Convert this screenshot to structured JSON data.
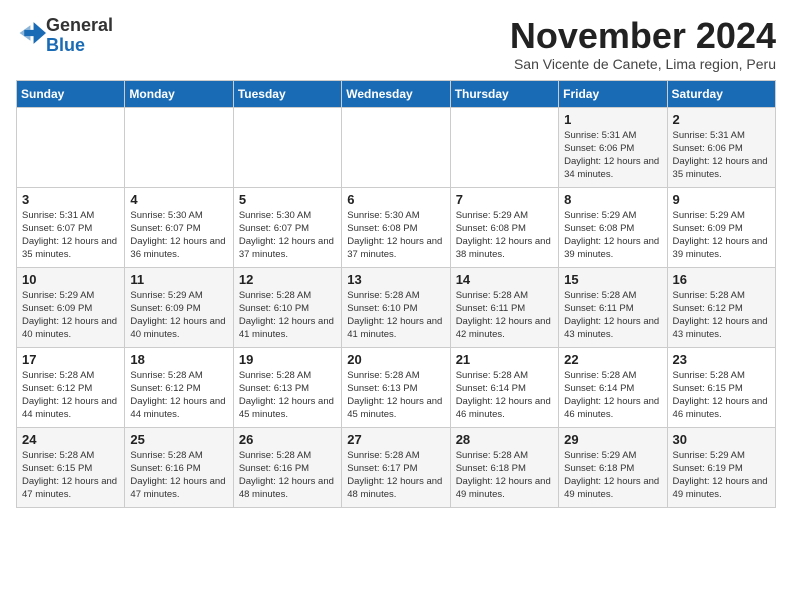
{
  "header": {
    "logo_general": "General",
    "logo_blue": "Blue",
    "month_year": "November 2024",
    "location": "San Vicente de Canete, Lima region, Peru"
  },
  "weekdays": [
    "Sunday",
    "Monday",
    "Tuesday",
    "Wednesday",
    "Thursday",
    "Friday",
    "Saturday"
  ],
  "weeks": [
    [
      {
        "day": "",
        "info": ""
      },
      {
        "day": "",
        "info": ""
      },
      {
        "day": "",
        "info": ""
      },
      {
        "day": "",
        "info": ""
      },
      {
        "day": "",
        "info": ""
      },
      {
        "day": "1",
        "info": "Sunrise: 5:31 AM\nSunset: 6:06 PM\nDaylight: 12 hours and 34 minutes."
      },
      {
        "day": "2",
        "info": "Sunrise: 5:31 AM\nSunset: 6:06 PM\nDaylight: 12 hours and 35 minutes."
      }
    ],
    [
      {
        "day": "3",
        "info": "Sunrise: 5:31 AM\nSunset: 6:07 PM\nDaylight: 12 hours and 35 minutes."
      },
      {
        "day": "4",
        "info": "Sunrise: 5:30 AM\nSunset: 6:07 PM\nDaylight: 12 hours and 36 minutes."
      },
      {
        "day": "5",
        "info": "Sunrise: 5:30 AM\nSunset: 6:07 PM\nDaylight: 12 hours and 37 minutes."
      },
      {
        "day": "6",
        "info": "Sunrise: 5:30 AM\nSunset: 6:08 PM\nDaylight: 12 hours and 37 minutes."
      },
      {
        "day": "7",
        "info": "Sunrise: 5:29 AM\nSunset: 6:08 PM\nDaylight: 12 hours and 38 minutes."
      },
      {
        "day": "8",
        "info": "Sunrise: 5:29 AM\nSunset: 6:08 PM\nDaylight: 12 hours and 39 minutes."
      },
      {
        "day": "9",
        "info": "Sunrise: 5:29 AM\nSunset: 6:09 PM\nDaylight: 12 hours and 39 minutes."
      }
    ],
    [
      {
        "day": "10",
        "info": "Sunrise: 5:29 AM\nSunset: 6:09 PM\nDaylight: 12 hours and 40 minutes."
      },
      {
        "day": "11",
        "info": "Sunrise: 5:29 AM\nSunset: 6:09 PM\nDaylight: 12 hours and 40 minutes."
      },
      {
        "day": "12",
        "info": "Sunrise: 5:28 AM\nSunset: 6:10 PM\nDaylight: 12 hours and 41 minutes."
      },
      {
        "day": "13",
        "info": "Sunrise: 5:28 AM\nSunset: 6:10 PM\nDaylight: 12 hours and 41 minutes."
      },
      {
        "day": "14",
        "info": "Sunrise: 5:28 AM\nSunset: 6:11 PM\nDaylight: 12 hours and 42 minutes."
      },
      {
        "day": "15",
        "info": "Sunrise: 5:28 AM\nSunset: 6:11 PM\nDaylight: 12 hours and 43 minutes."
      },
      {
        "day": "16",
        "info": "Sunrise: 5:28 AM\nSunset: 6:12 PM\nDaylight: 12 hours and 43 minutes."
      }
    ],
    [
      {
        "day": "17",
        "info": "Sunrise: 5:28 AM\nSunset: 6:12 PM\nDaylight: 12 hours and 44 minutes."
      },
      {
        "day": "18",
        "info": "Sunrise: 5:28 AM\nSunset: 6:12 PM\nDaylight: 12 hours and 44 minutes."
      },
      {
        "day": "19",
        "info": "Sunrise: 5:28 AM\nSunset: 6:13 PM\nDaylight: 12 hours and 45 minutes."
      },
      {
        "day": "20",
        "info": "Sunrise: 5:28 AM\nSunset: 6:13 PM\nDaylight: 12 hours and 45 minutes."
      },
      {
        "day": "21",
        "info": "Sunrise: 5:28 AM\nSunset: 6:14 PM\nDaylight: 12 hours and 46 minutes."
      },
      {
        "day": "22",
        "info": "Sunrise: 5:28 AM\nSunset: 6:14 PM\nDaylight: 12 hours and 46 minutes."
      },
      {
        "day": "23",
        "info": "Sunrise: 5:28 AM\nSunset: 6:15 PM\nDaylight: 12 hours and 46 minutes."
      }
    ],
    [
      {
        "day": "24",
        "info": "Sunrise: 5:28 AM\nSunset: 6:15 PM\nDaylight: 12 hours and 47 minutes."
      },
      {
        "day": "25",
        "info": "Sunrise: 5:28 AM\nSunset: 6:16 PM\nDaylight: 12 hours and 47 minutes."
      },
      {
        "day": "26",
        "info": "Sunrise: 5:28 AM\nSunset: 6:16 PM\nDaylight: 12 hours and 48 minutes."
      },
      {
        "day": "27",
        "info": "Sunrise: 5:28 AM\nSunset: 6:17 PM\nDaylight: 12 hours and 48 minutes."
      },
      {
        "day": "28",
        "info": "Sunrise: 5:28 AM\nSunset: 6:18 PM\nDaylight: 12 hours and 49 minutes."
      },
      {
        "day": "29",
        "info": "Sunrise: 5:29 AM\nSunset: 6:18 PM\nDaylight: 12 hours and 49 minutes."
      },
      {
        "day": "30",
        "info": "Sunrise: 5:29 AM\nSunset: 6:19 PM\nDaylight: 12 hours and 49 minutes."
      }
    ]
  ]
}
